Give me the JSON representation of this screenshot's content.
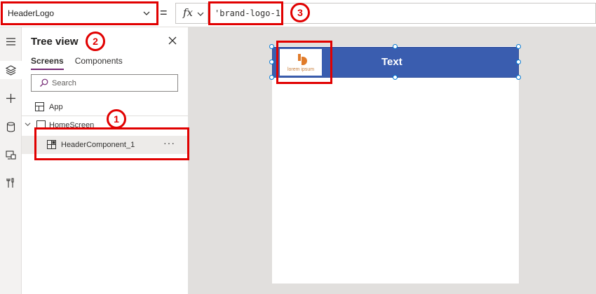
{
  "formula_bar": {
    "property_value": "HeaderLogo",
    "equals": "=",
    "fx_label": "fx",
    "formula": "'brand-logo-1'"
  },
  "rail": {
    "icons": [
      "hamburger-icon",
      "layers-icon",
      "plus-icon",
      "database-icon",
      "media-icon",
      "tools-icon"
    ]
  },
  "tree_view": {
    "title": "Tree view",
    "tabs": [
      {
        "label": "Screens",
        "active": true
      },
      {
        "label": "Components",
        "active": false
      }
    ],
    "search_placeholder": "Search",
    "app_label": "App",
    "screen_label": "HomeScreen",
    "component_label": "HeaderComponent_1",
    "more_label": "···"
  },
  "canvas": {
    "header_text": "Text",
    "logo_text": "lorem ipsum",
    "header_color": "#3a5daf"
  },
  "callouts": [
    {
      "number": "1"
    },
    {
      "number": "2"
    },
    {
      "number": "3"
    }
  ],
  "colors": {
    "callout": "#e10000",
    "accent": "#742774",
    "logo_orange": "#e07b2a"
  }
}
